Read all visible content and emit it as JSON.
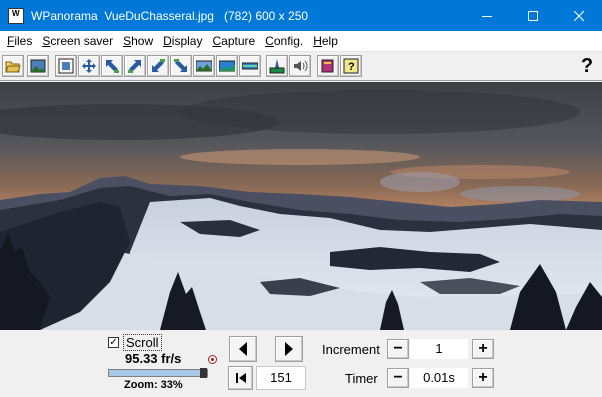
{
  "window": {
    "title": "WPanorama  VueDuChasseral.jpg   (782) 600 x 250"
  },
  "menu": {
    "items": [
      {
        "label": "Files",
        "accel": "F"
      },
      {
        "label": "Screen saver",
        "accel": "S"
      },
      {
        "label": "Show",
        "accel": "S"
      },
      {
        "label": "Display",
        "accel": "D"
      },
      {
        "label": "Capture",
        "accel": "C"
      },
      {
        "label": "Config.",
        "accel": "C"
      },
      {
        "label": "Help",
        "accel": "H"
      }
    ]
  },
  "toolbar": {
    "help_label": "?",
    "buttons": [
      "open-folder-icon",
      "image-icon",
      "frame-icon",
      "fit-arrows-icon",
      "arrow-upleft-icon",
      "arrow-upright-icon",
      "arrow-downleft-icon",
      "arrow-downright-icon",
      "panorama-icon",
      "panorama-blue-icon",
      "strip-icon",
      "landscape-icon",
      "speaker-icon",
      "book-icon",
      "help-scroll-icon"
    ]
  },
  "controls": {
    "scroll_label": "Scroll",
    "scroll_checked": true,
    "speed": "95.33 fr/s",
    "zoom_label": "Zoom: 33%",
    "zoom_fraction": 0.33,
    "position": "151",
    "increment_label": "Increment",
    "increment_value": "1",
    "timer_label": "Timer",
    "timer_value": "0.01s",
    "minus": "−",
    "plus": "+"
  },
  "colors": {
    "titlebar": "#0078d7",
    "sky_top": "#3f4449",
    "sky_glow": "#c98a5c",
    "snow": "#dfe4ec",
    "forest": "#1f2430"
  }
}
